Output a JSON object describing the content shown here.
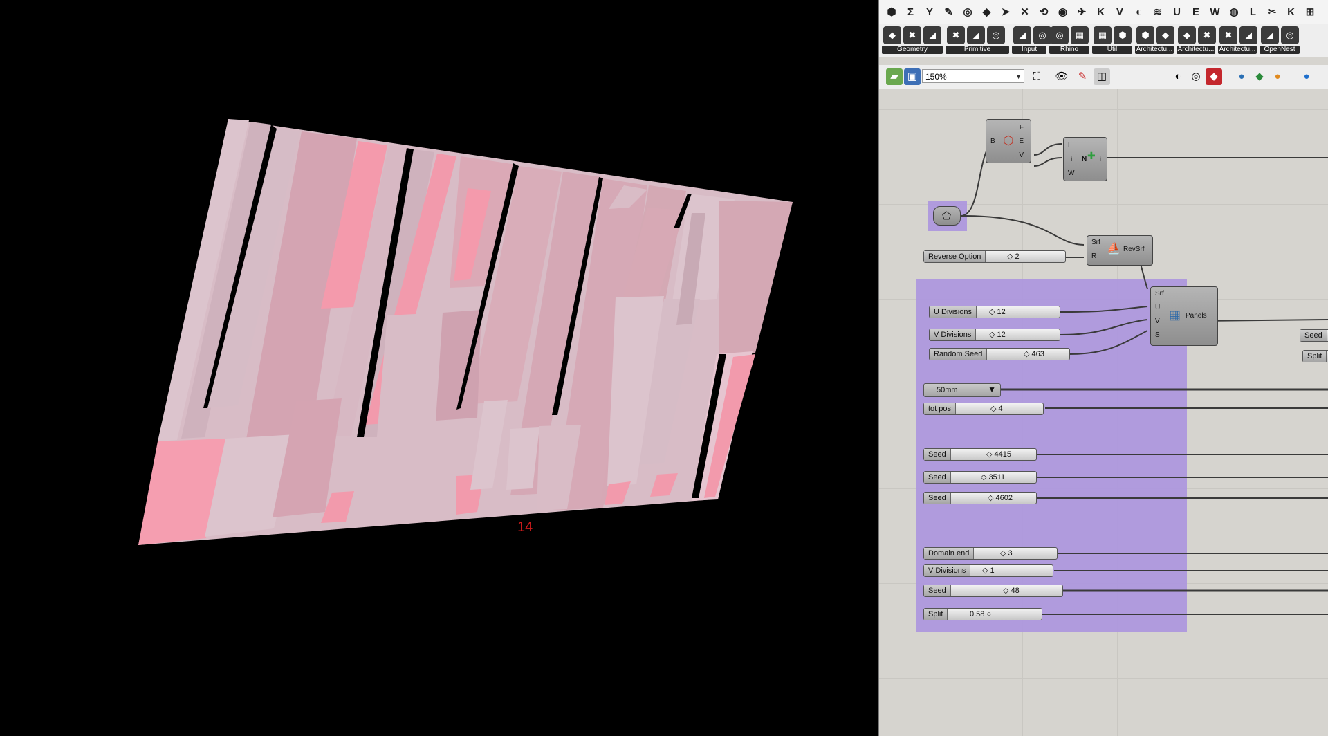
{
  "viewport": {
    "annotation": "14",
    "annotation_color": "#cc1b1b"
  },
  "toolbar_top": {
    "icons": [
      "⬢",
      "Σ",
      "Y",
      "✎",
      "◎",
      "◆",
      "➤",
      "✕",
      "⟲",
      "◉",
      "✈",
      "K",
      "V",
      "◐",
      "≋",
      "U",
      "E",
      "W",
      "◍",
      "L",
      "✂",
      "K",
      "⊞"
    ]
  },
  "ribbon": {
    "groups": [
      {
        "label": "Geometry"
      },
      {
        "label": "Primitive"
      },
      {
        "label": "Input"
      },
      {
        "label": "Rhino"
      },
      {
        "label": "Util"
      },
      {
        "label": "Architectu..."
      },
      {
        "label": "Architectu..."
      },
      {
        "label": "Architectu..."
      },
      {
        "label": "OpenNest"
      }
    ]
  },
  "canvas_toolbar": {
    "zoom": "150%"
  },
  "graph": {
    "brep_comp": {
      "inputs": [
        "B"
      ],
      "outputs": [
        "F",
        "E",
        "V"
      ]
    },
    "line_comp": {
      "inputs": [
        "L",
        "i",
        "W"
      ],
      "outputs": [
        "i"
      ],
      "center": "N"
    },
    "revsrf_comp": {
      "inputs": [
        "Srf",
        "R"
      ],
      "name": "RevSrf"
    },
    "panels_comp": {
      "inputs": [
        "Srf",
        "U",
        "V",
        "S"
      ],
      "name": "Panels"
    },
    "reverse_option": {
      "label": "Reverse Option",
      "value": "2"
    },
    "sliders": [
      {
        "label": "U Divisions",
        "value": "12"
      },
      {
        "label": "V Divisions",
        "value": "12"
      },
      {
        "label": "Random Seed",
        "value": "463"
      },
      {
        "label": "tot pos",
        "value": "4"
      },
      {
        "label": "Seed",
        "value": "4415"
      },
      {
        "label": "Seed",
        "value": "3511"
      },
      {
        "label": "Seed",
        "value": "4602"
      },
      {
        "label": "Domain end",
        "value": "3"
      },
      {
        "label": "V Divisions",
        "value": "1"
      },
      {
        "label": "Seed",
        "value": "48"
      },
      {
        "label": "Split",
        "value": "0.58"
      }
    ],
    "value_list": {
      "value": "50mm"
    },
    "offscreen_labels": [
      "Seed",
      "Split"
    ]
  }
}
